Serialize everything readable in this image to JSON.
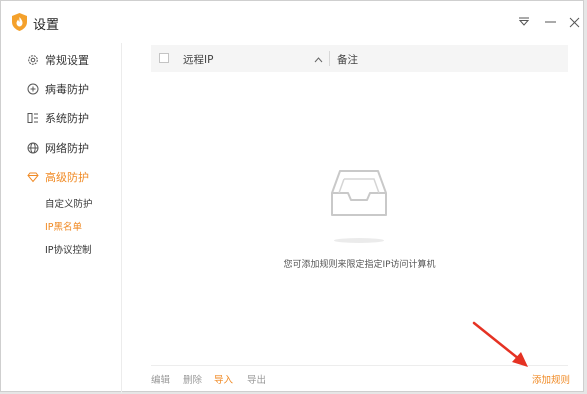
{
  "window": {
    "title": "设置",
    "icons": [
      "logo-icon",
      "menu-icon",
      "minimize-icon",
      "close-icon"
    ]
  },
  "sidebar": {
    "items": [
      {
        "label": "常规设置",
        "icon": "gear-icon"
      },
      {
        "label": "病毒防护",
        "icon": "virus-shield-icon"
      },
      {
        "label": "系统防护",
        "icon": "system-icon"
      },
      {
        "label": "网络防护",
        "icon": "globe-icon"
      },
      {
        "label": "高级防护",
        "icon": "diamond-icon",
        "active": true
      }
    ],
    "sub_items": [
      {
        "label": "自定义防护"
      },
      {
        "label": "IP黑名单",
        "active": true
      },
      {
        "label": "IP协议控制"
      }
    ]
  },
  "table": {
    "columns": [
      "远程IP",
      "备注"
    ],
    "empty_message": "您可添加规则来限定指定IP访问计算机"
  },
  "actions": {
    "edit": "编辑",
    "delete": "删除",
    "import": "导入",
    "export": "导出",
    "add_rule": "添加规则"
  },
  "colors": {
    "accent": "#f08a24",
    "annotation": "#e53223"
  }
}
